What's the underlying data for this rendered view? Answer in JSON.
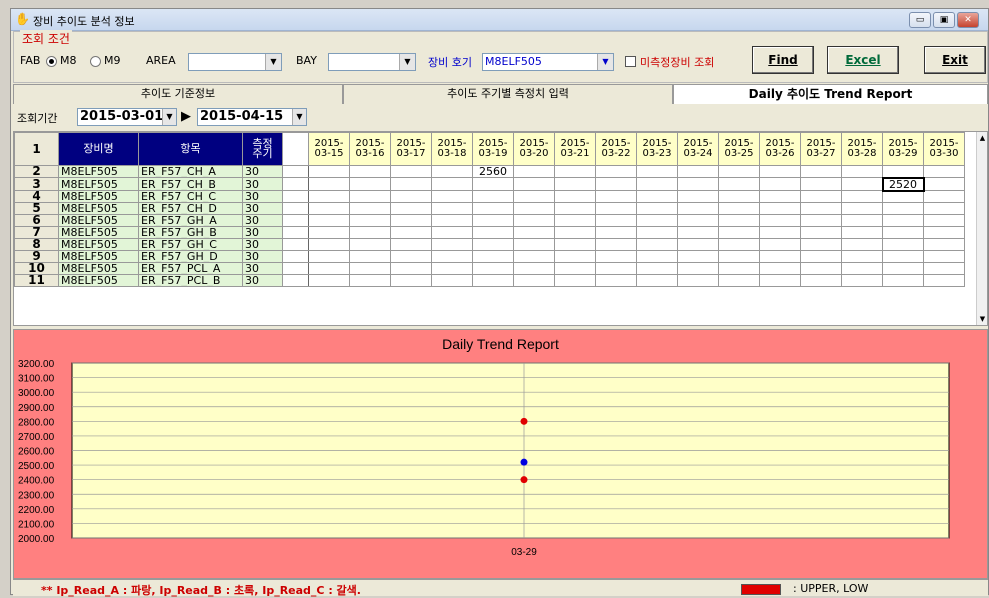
{
  "window": {
    "title": "장비 추이도 분석 정보",
    "min": "▭",
    "max": "▣",
    "close": "✕"
  },
  "conditions": {
    "legend": "조회 조건",
    "fab_label": "FAB",
    "fab_options": [
      "M8",
      "M9"
    ],
    "fab_selected": "M8",
    "area_label": "AREA",
    "area_value": "",
    "bay_label": "BAY",
    "bay_value": "",
    "equip_label": "장비 호기",
    "equip_value": "M8ELF505",
    "unmeasured_label": "미측정장비 조회",
    "find_label": "Find",
    "excel_label": "Excel",
    "exit_label": "Exit"
  },
  "tabs": [
    {
      "label": "추이도 기준정보",
      "active": false
    },
    {
      "label": "추이도 주기별 측정치 입력",
      "active": false
    },
    {
      "label": "Daily 추이도 Trend Report",
      "active": true
    }
  ],
  "period": {
    "label": "조회기간",
    "from": "2015-03-01",
    "to": "2015-04-15",
    "arrow": "▶"
  },
  "grid": {
    "header_rownum": "1",
    "col_equip": "장비명",
    "col_item": "항목",
    "col_cycle": "측정\n주기",
    "dates": [
      "2015-\n03-15",
      "2015-\n03-16",
      "2015-\n03-17",
      "2015-\n03-18",
      "2015-\n03-19",
      "2015-\n03-20",
      "2015-\n03-21",
      "2015-\n03-22",
      "2015-\n03-23",
      "2015-\n03-24",
      "2015-\n03-25",
      "2015-\n03-26",
      "2015-\n03-27",
      "2015-\n03-28",
      "2015-\n03-29",
      "2015-\n03-30"
    ],
    "rows": [
      {
        "n": "2",
        "equip": "M8ELF505",
        "item": "ER_F57_CH_A",
        "cycle": "30",
        "values": {
          "4": "2560"
        }
      },
      {
        "n": "3",
        "equip": "M8ELF505",
        "item": "ER_F57_CH_B",
        "cycle": "30",
        "values": {
          "14": "2520"
        }
      },
      {
        "n": "4",
        "equip": "M8ELF505",
        "item": "ER_F57_CH_C",
        "cycle": "30",
        "values": {}
      },
      {
        "n": "5",
        "equip": "M8ELF505",
        "item": "ER_F57_CH_D",
        "cycle": "30",
        "values": {}
      },
      {
        "n": "6",
        "equip": "M8ELF505",
        "item": "ER_F57_GH_A",
        "cycle": "30",
        "values": {}
      },
      {
        "n": "7",
        "equip": "M8ELF505",
        "item": "ER_F57_GH_B",
        "cycle": "30",
        "values": {}
      },
      {
        "n": "8",
        "equip": "M8ELF505",
        "item": "ER_F57_GH_C",
        "cycle": "30",
        "values": {}
      },
      {
        "n": "9",
        "equip": "M8ELF505",
        "item": "ER_F57_GH_D",
        "cycle": "30",
        "values": {}
      },
      {
        "n": "10",
        "equip": "M8ELF505",
        "item": "ER_F57_PCL_A",
        "cycle": "30",
        "values": {}
      },
      {
        "n": "11",
        "equip": "M8ELF505",
        "item": "ER_F57_PCL_B",
        "cycle": "30",
        "values": {}
      }
    ]
  },
  "chart_data": {
    "type": "scatter",
    "title": "Daily Trend Report",
    "categories": [
      "03-29"
    ],
    "ylim": [
      2000,
      3200
    ],
    "yticks": [
      "3200.00",
      "3100.00",
      "3000.00",
      "2900.00",
      "2800.00",
      "2700.00",
      "2600.00",
      "2500.00",
      "2400.00",
      "2300.00",
      "2200.00",
      "2100.00",
      "2000.00"
    ],
    "series": [
      {
        "color": "#e00000",
        "values": [
          2800
        ]
      },
      {
        "color": "#0000e0",
        "values": [
          2520
        ]
      },
      {
        "color": "#e00000",
        "values": [
          2400
        ]
      }
    ],
    "plot_bg": "#ffffc8",
    "frame_bg": "#ff8080",
    "grid": true
  },
  "footer": {
    "note": "** Ip_Read_A : 파랑,  Ip_Read_B : 초록,  Ip_Read_C : 갈색.",
    "legend": ": UPPER, LOW"
  }
}
